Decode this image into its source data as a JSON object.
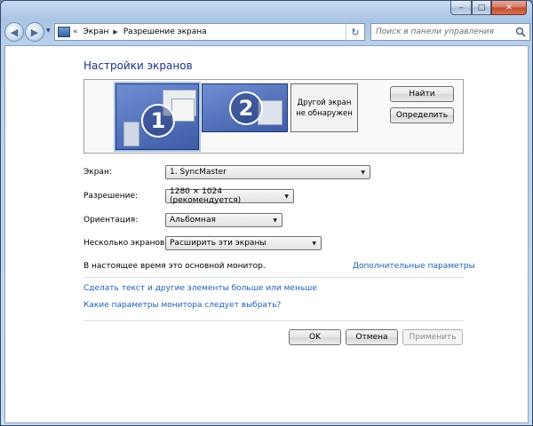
{
  "window": {
    "minimize_glyph": "‒",
    "maximize_glyph": "□",
    "close_glyph": "✕"
  },
  "nav": {
    "back_glyph": "◀",
    "forward_glyph": "▶",
    "history_glyph": "▼"
  },
  "address": {
    "overflow_glyph": "«",
    "crumbs": [
      "Экран",
      "Разрешение экрана"
    ],
    "separator_glyph": "▶",
    "dropdown_glyph": "▼",
    "refresh_glyph": "↻"
  },
  "search": {
    "placeholder": "Поиск в панели управления"
  },
  "page": {
    "title": "Настройки экранов"
  },
  "monitors": {
    "primary_number": "1",
    "secondary_number": "2",
    "not_detected_line1": "Другой экран",
    "not_detected_line2": "не обнаружен",
    "find_label": "Найти",
    "identify_label": "Определить"
  },
  "settings": {
    "screen_label": "Экран:",
    "screen_value": "1. SyncMaster",
    "resolution_label": "Разрешение:",
    "resolution_value": "1280 × 1024 (рекомендуется)",
    "orientation_label": "Ориентация:",
    "orientation_value": "Альбомная",
    "multi_label": "Несколько экранов:",
    "multi_value": "Расширить эти экраны",
    "select_arrow": "▼"
  },
  "info": {
    "status": "В настоящее время это основной монитор.",
    "advanced_link": "Дополнительные параметры"
  },
  "links": {
    "text_size": "Сделать текст и другие элементы больше или меньше",
    "which_params": "Какие параметры монитора следует выбрать?"
  },
  "footer": {
    "ok": "OK",
    "cancel": "Отмена",
    "apply": "Применить"
  },
  "colors": {
    "title": "#1e3287",
    "link": "#1d5fb5",
    "monitor_fill": "#4f6fbd"
  }
}
